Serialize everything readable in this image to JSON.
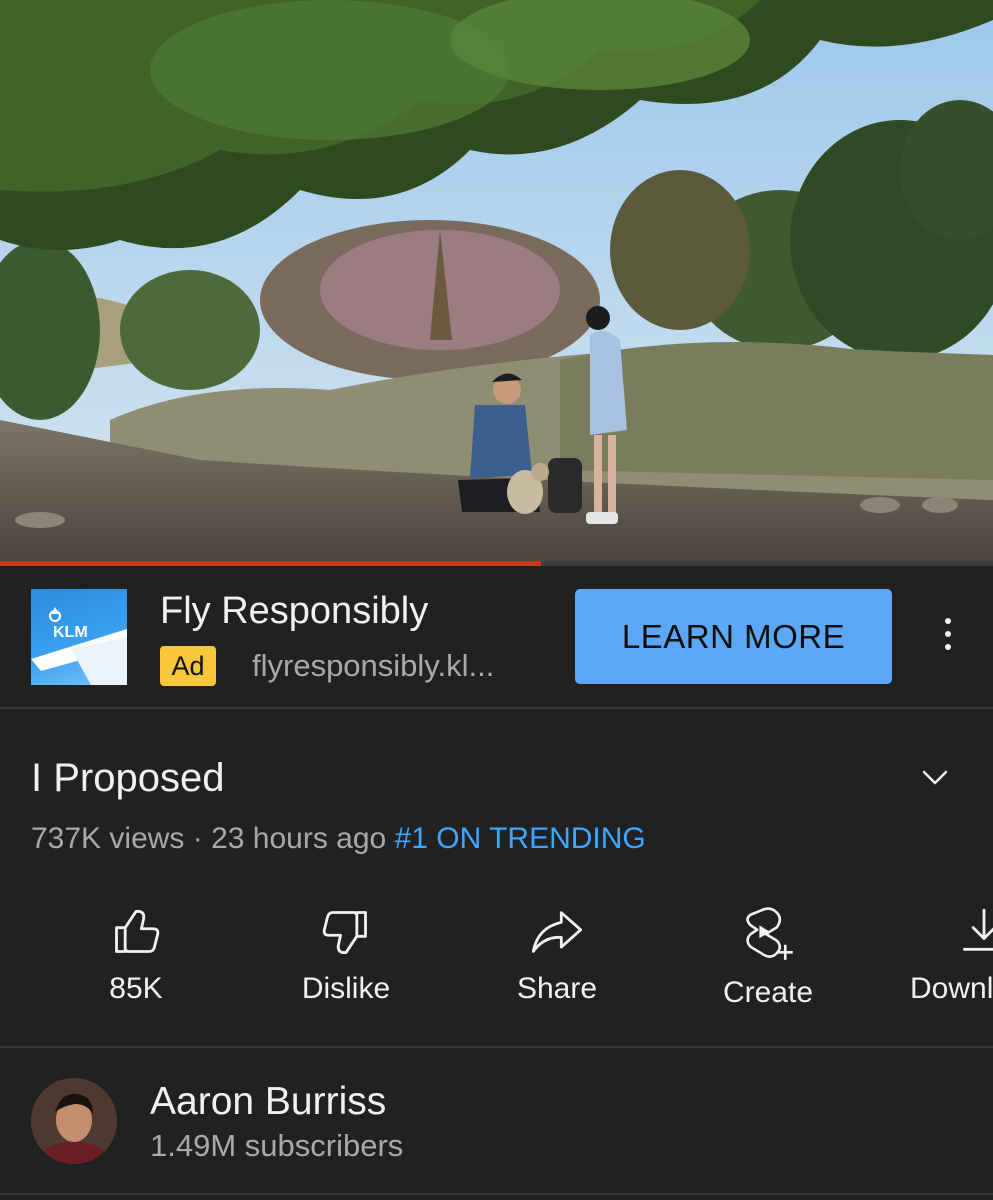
{
  "video": {
    "progress_fraction": 0.545,
    "progress_color": "#e5261d"
  },
  "ad": {
    "title": "Fly Responsibly",
    "badge": "Ad",
    "url": "flyresponsibly.kl...",
    "thumb_brand": "KLM",
    "cta_label": "LEARN MORE",
    "cta_color": "#5ca8f6",
    "more_icon": "more-vertical-icon"
  },
  "video_info": {
    "title": "I Proposed",
    "views": "737K views",
    "separator": " · ",
    "age": "23 hours ago",
    "trending": "#1 ON TRENDING",
    "trending_color": "#3ea6ff",
    "expand_icon": "chevron-down-icon"
  },
  "actions": [
    {
      "label": "85K",
      "icon": "thumbs-up-icon"
    },
    {
      "label": "Dislike",
      "icon": "thumbs-down-icon"
    },
    {
      "label": "Share",
      "icon": "share-icon"
    },
    {
      "label": "Create",
      "icon": "create-icon"
    },
    {
      "label": "Downl",
      "icon": "download-icon"
    }
  ],
  "channel": {
    "name": "Aaron Burriss",
    "subscribers": "1.49M subscribers"
  }
}
